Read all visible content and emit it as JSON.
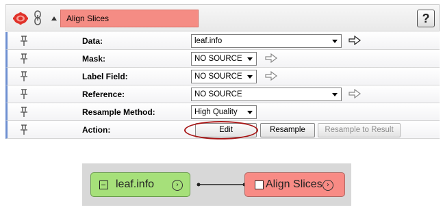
{
  "module": {
    "title": "Align Slices",
    "help_label": "?"
  },
  "rows": [
    {
      "label": "Data:",
      "control": "select",
      "value": "leaf.info"
    },
    {
      "label": "Mask:",
      "control": "select",
      "value": "NO SOURCE"
    },
    {
      "label": "Label Field:",
      "control": "select",
      "value": "NO SOURCE"
    },
    {
      "label": "Reference:",
      "control": "select",
      "value": "NO SOURCE"
    },
    {
      "label": "Resample Method:",
      "control": "select",
      "value": "High Quality"
    },
    {
      "label": "Action:",
      "control": "buttons"
    }
  ],
  "actions": {
    "edit": "Edit",
    "resample": "Resample",
    "resample_to_result": "Resample to Result"
  },
  "network": {
    "source_node": "leaf.info",
    "target_node": "Align Slices",
    "source_state_icon": "collapse-box-icon",
    "target_state_icon": "checkbox-icon",
    "port_icon": "chevron-right-circle-icon"
  },
  "colors": {
    "module_title_bg": "#f58c84",
    "source_node_bg": "#a6e07a",
    "target_node_bg": "#f88b85",
    "row_accent": "#6d8fd1",
    "highlight_oval": "#a81717"
  }
}
